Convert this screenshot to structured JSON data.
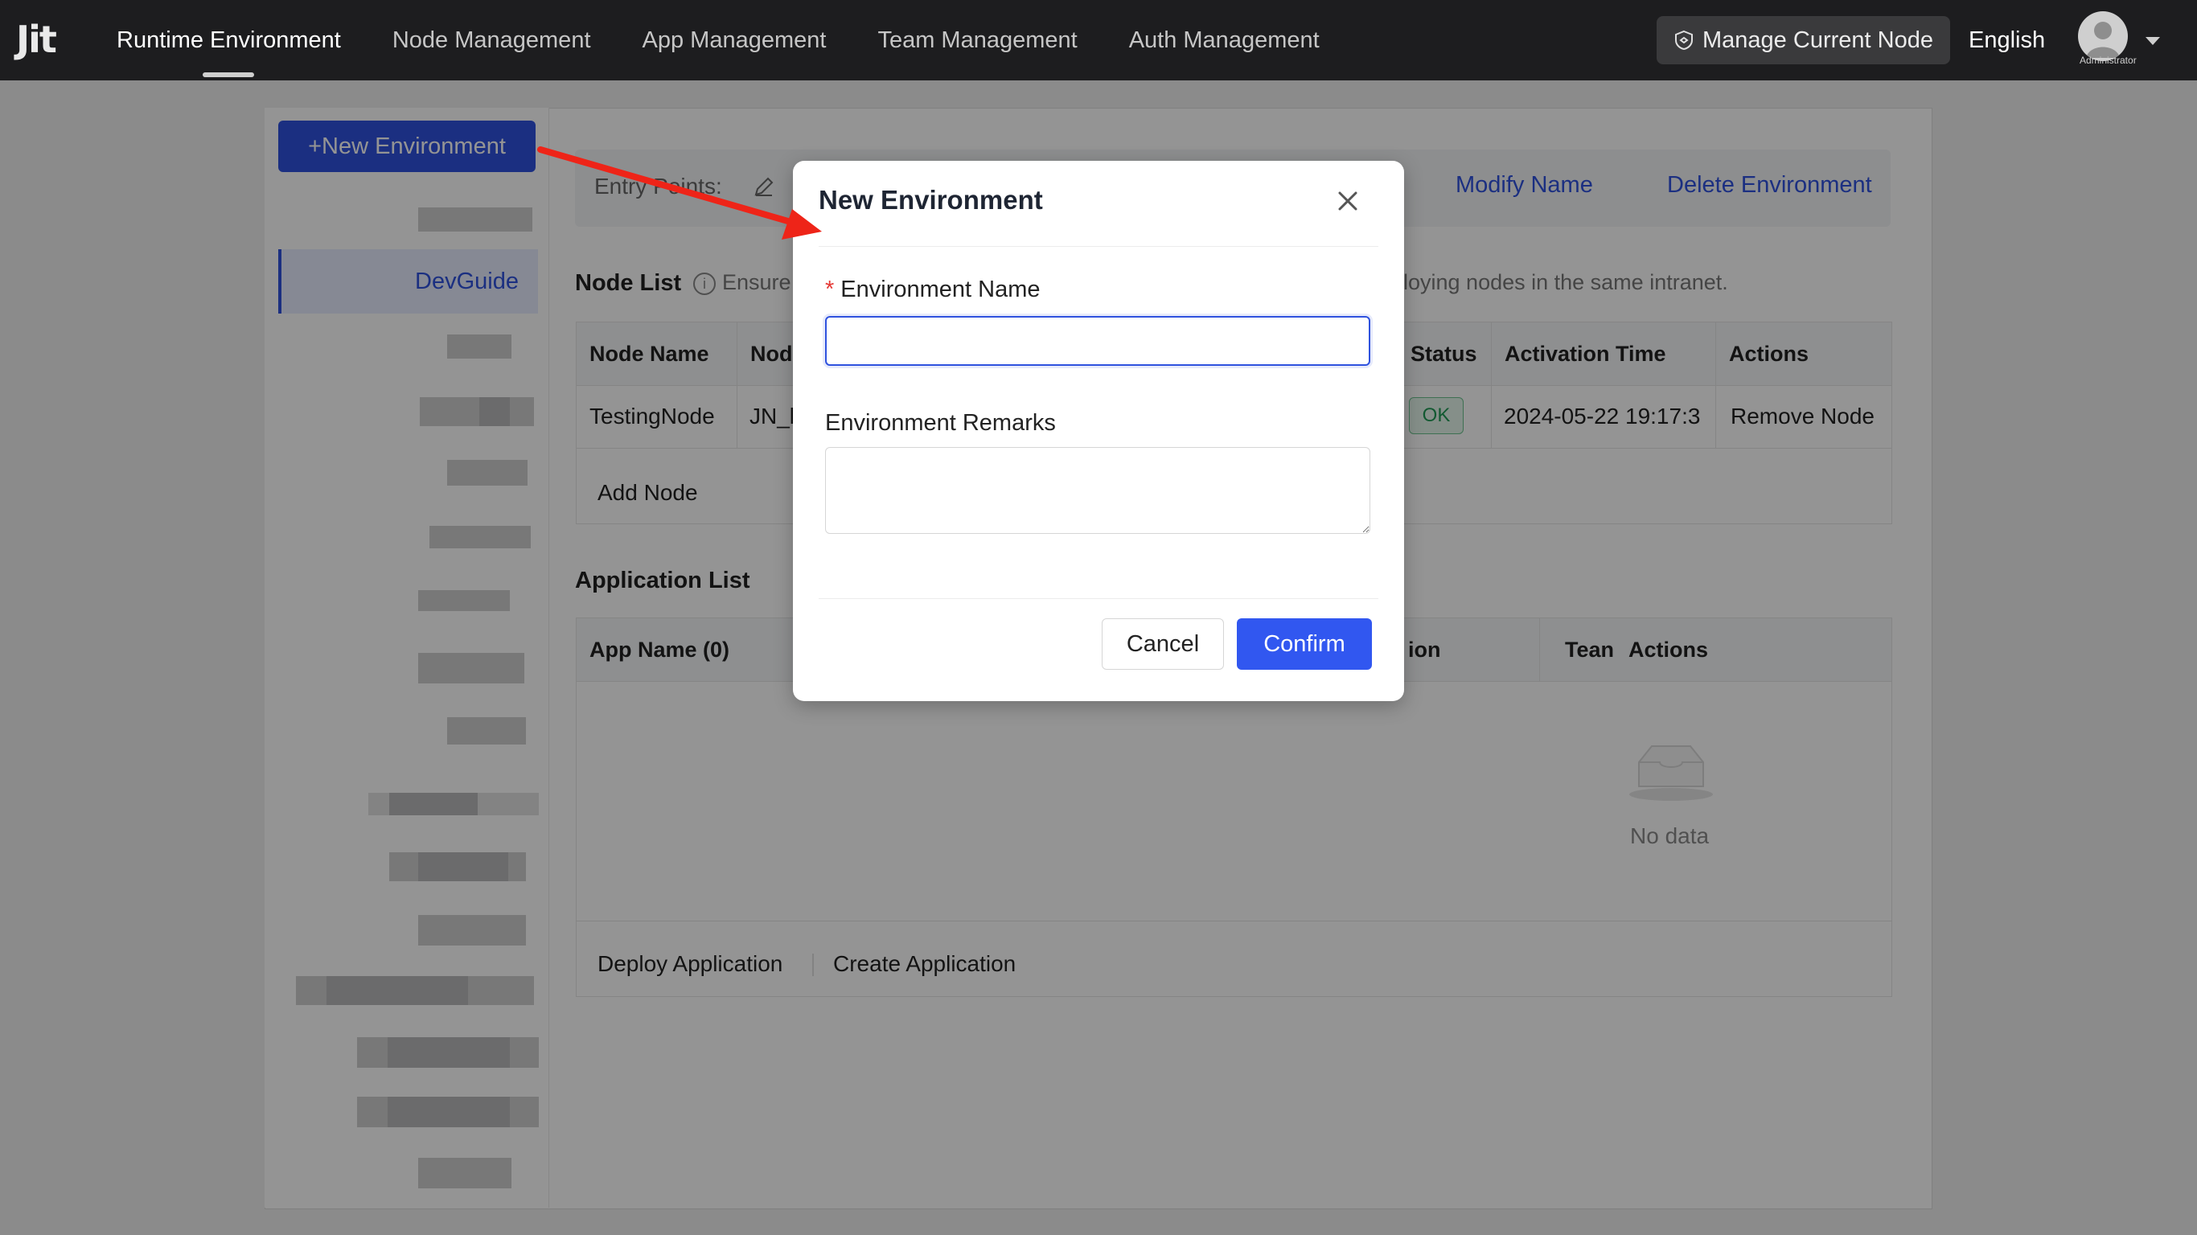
{
  "app": {
    "logo": "Jit"
  },
  "nav": {
    "items": [
      {
        "label": "Runtime Environment",
        "active": true
      },
      {
        "label": "Node Management",
        "active": false
      },
      {
        "label": "App Management",
        "active": false
      },
      {
        "label": "Team Management",
        "active": false
      },
      {
        "label": "Auth Management",
        "active": false
      }
    ],
    "manage_node": "Manage Current Node",
    "language": "English",
    "user_role": "Administrator"
  },
  "sidebar": {
    "new_env_button": "+New Environment",
    "active_item": "DevGuide"
  },
  "environment": {
    "entry_points_label": "Entry Points:",
    "modify_name": "Modify Name",
    "delete_environment": "Delete Environment"
  },
  "node_list": {
    "title": "Node List",
    "hint_start": "Ensure",
    "hint_end": "loying nodes in the same intranet.",
    "columns": [
      "Node Name",
      "Nod",
      "Status",
      "Activation Time",
      "Actions"
    ],
    "rows": [
      {
        "name": "TestingNode",
        "node": "JN_l",
        "status": "OK",
        "activation_time": "2024-05-22 19:17:3",
        "action": "Remove Node"
      }
    ],
    "add_node": "Add Node"
  },
  "app_list": {
    "title": "Application List",
    "columns": [
      "App Name (0)",
      "ion",
      "Tean",
      "Actions"
    ],
    "empty_text": "No data",
    "deploy": "Deploy Application",
    "create": "Create Application"
  },
  "modal": {
    "title": "New Environment",
    "name_label": "Environment Name",
    "required_mark": "*",
    "name_value": "",
    "remarks_label": "Environment Remarks",
    "remarks_value": "",
    "cancel": "Cancel",
    "confirm": "Confirm"
  },
  "colors": {
    "primary": "#2f52de",
    "confirm": "#3157f0",
    "arrow": "#ee2418",
    "topbar": "#1d1d1f"
  },
  "icons": [
    "edit-icon",
    "info-icon",
    "close-icon",
    "shield-icon",
    "avatar-icon",
    "chevron-down-icon",
    "empty-box-icon"
  ]
}
